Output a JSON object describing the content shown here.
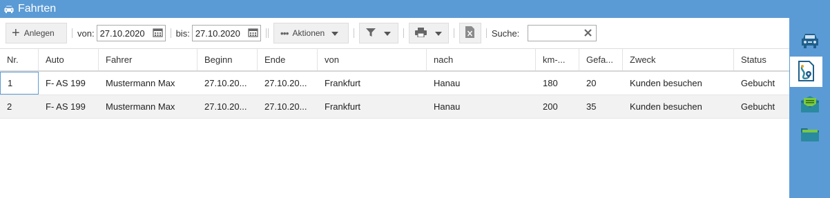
{
  "window": {
    "title": "Fahrten",
    "icon": "car-icon"
  },
  "toolbar": {
    "add_label": "Anlegen",
    "from_label": "von:",
    "from_value": "27.10.2020",
    "to_label": "bis:",
    "to_value": "27.10.2020",
    "actions_label": "Aktionen",
    "search_label": "Suche:",
    "search_value": ""
  },
  "table": {
    "columns": [
      "Nr.",
      "Auto",
      "Fahrer",
      "Beginn",
      "Ende",
      "von",
      "nach",
      "km-...",
      "Gefa...",
      "Zweck",
      "Status"
    ],
    "rows": [
      [
        "1",
        "F- AS 199",
        "Mustermann Max",
        "27.10.20...",
        "27.10.20...",
        "Frankfurt",
        "Hanau",
        "180",
        "20",
        "Kunden besuchen",
        "Gebucht"
      ],
      [
        "2",
        "F- AS 199",
        "Mustermann Max",
        "27.10.20...",
        "27.10.20...",
        "Frankfurt",
        "Hanau",
        "200",
        "35",
        "Kunden besuchen",
        "Gebucht"
      ]
    ]
  },
  "sidebar": {
    "items": [
      {
        "icon": "car-icon",
        "active": false
      },
      {
        "icon": "route-document-icon",
        "active": true
      },
      {
        "icon": "mail-icon",
        "active": false
      },
      {
        "icon": "folder-icon",
        "active": false
      }
    ]
  },
  "colors": {
    "accent": "#5b9bd5",
    "row_alt": "#f2f2f2"
  }
}
